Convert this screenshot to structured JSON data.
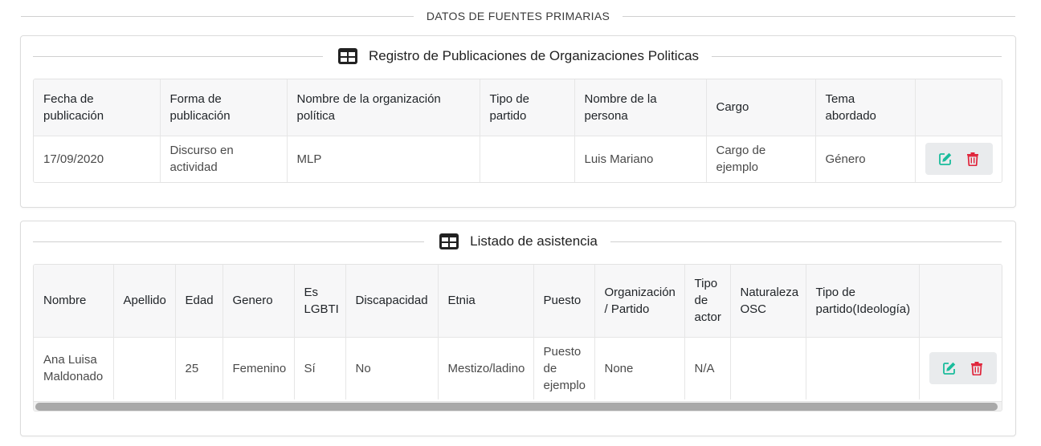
{
  "section_heading": "DATOS DE FUENTES PRIMARIAS",
  "publications": {
    "title": "Registro de Publicaciones de Organizaciones Politicas",
    "icon": "table-icon",
    "columns": [
      "Fecha de publicación",
      "Forma de publicación",
      "Nombre de la organización política",
      "Tipo de partido",
      "Nombre de la persona",
      "Cargo",
      "Tema abordado",
      ""
    ],
    "rows": [
      {
        "fecha": "17/09/2020",
        "forma": "Discurso en actividad",
        "organizacion": "MLP",
        "tipo_partido": "",
        "persona": "Luis Mariano",
        "cargo": "Cargo de ejemplo",
        "tema": "Género"
      }
    ]
  },
  "attendance": {
    "title": "Listado de asistencia",
    "icon": "table-icon",
    "columns": [
      "Nombre",
      "Apellido",
      "Edad",
      "Genero",
      "Es LGBTI",
      "Discapacidad",
      "Etnia",
      "Puesto",
      "Organización / Partido",
      "Tipo de actor",
      "Naturaleza OSC",
      "Tipo de partido(Ideología)",
      ""
    ],
    "rows": [
      {
        "nombre": "Ana Luisa Maldonado",
        "apellido": "",
        "edad": "25",
        "genero": "Femenino",
        "lgbti": "Sí",
        "discapacidad": "No",
        "etnia": "Mestizo/ladino",
        "puesto": "Puesto de ejemplo",
        "organizacion": "None",
        "tipo_actor": "N/A",
        "naturaleza": "",
        "tipo_partido": ""
      }
    ]
  },
  "actions": {
    "edit_icon": "edit-icon",
    "delete_icon": "trash-icon"
  },
  "colors": {
    "edit": "#1abc9c",
    "delete": "#e0243a",
    "header_bg": "#f7f7f8",
    "scroll_thumb": "#a9a9a9"
  }
}
